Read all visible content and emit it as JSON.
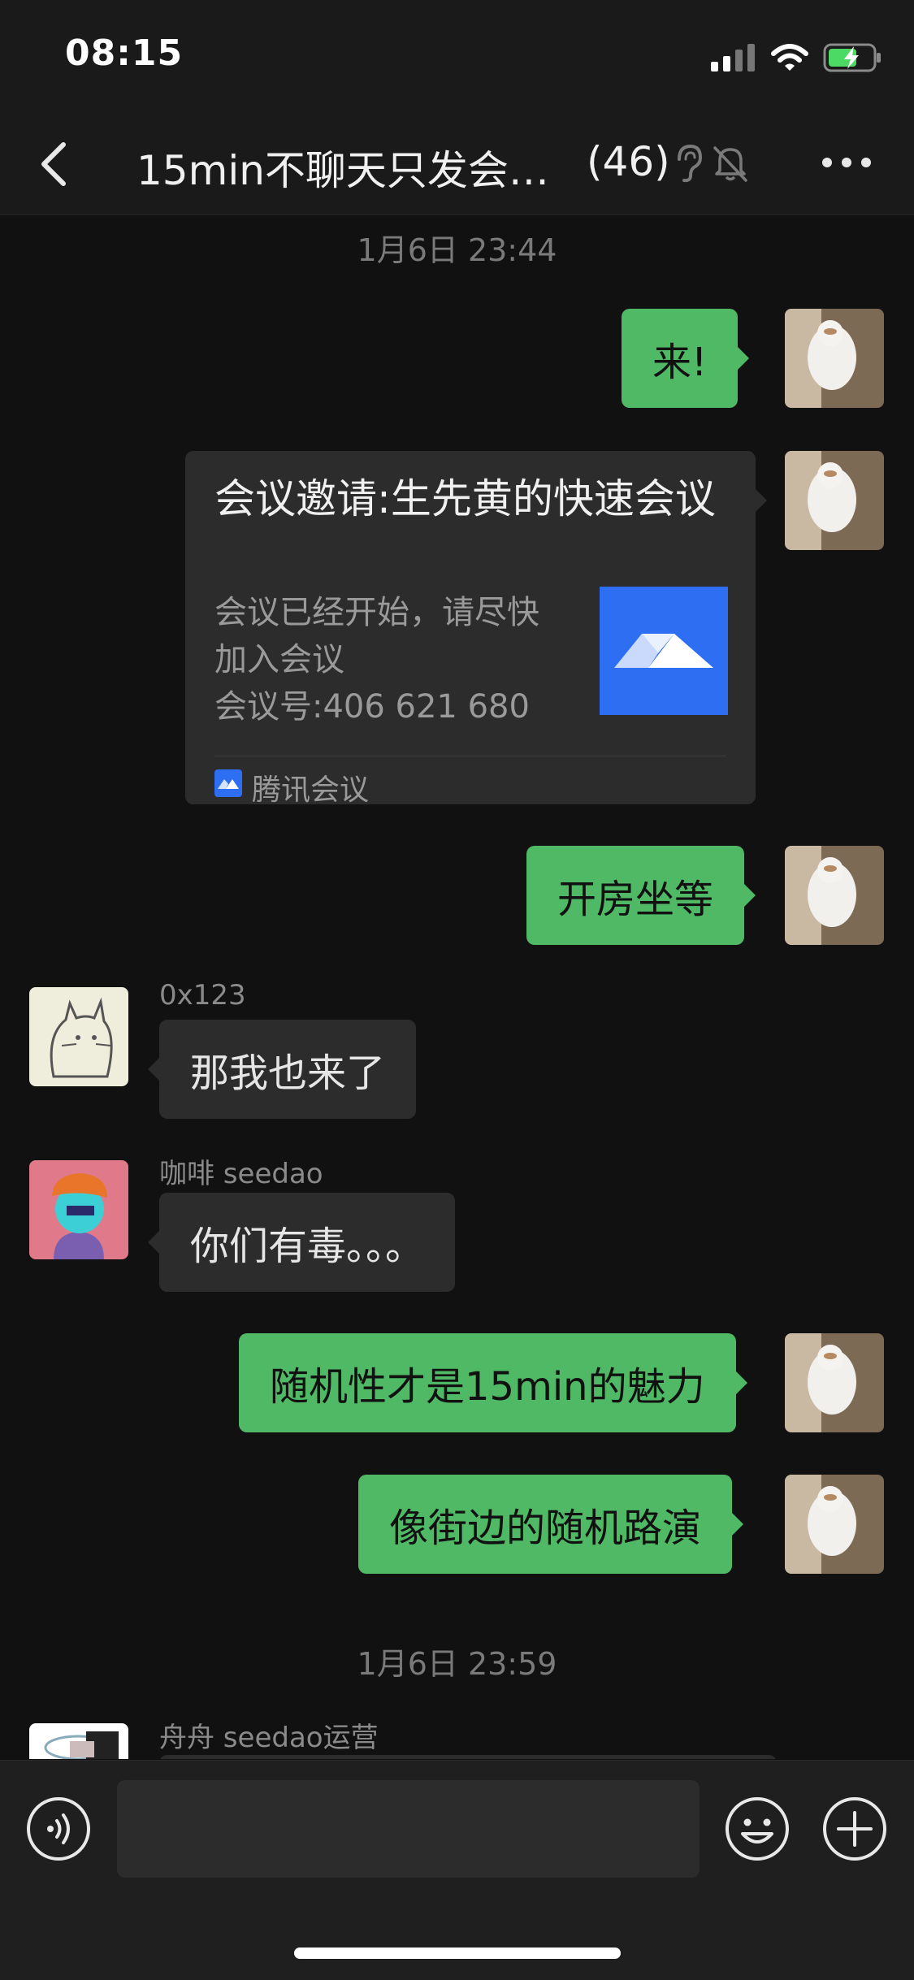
{
  "status_bar": {
    "time": "08:15",
    "icons": [
      "signal-icon",
      "wifi-icon",
      "battery-charging-icon"
    ]
  },
  "header": {
    "title": "15min不聊天只发会…",
    "member_count": "(46)",
    "icons": [
      "back-icon",
      "ear-icon",
      "mute-bell-icon",
      "more-icon"
    ]
  },
  "chat": {
    "timestamp_1": "1月6日 23:44",
    "messages": [
      {
        "from": "me",
        "text": "来!"
      },
      {
        "from": "me",
        "type": "card",
        "title": "会议邀请:生先黄的快速会议",
        "desc_line1": "会议已经开始，请尽快",
        "desc_line2": "加入会议",
        "desc_line3": "会议号:406 621 680",
        "source": "腾讯会议"
      },
      {
        "from": "me",
        "text": "开房坐等"
      },
      {
        "from": "other",
        "sender": "0x123",
        "text": "那我也来了"
      },
      {
        "from": "other",
        "sender": "咖啡 seedao",
        "text": "你们有毒。。。"
      },
      {
        "from": "me",
        "text": "随机性才是15min的魅力"
      },
      {
        "from": "me",
        "text": "像街边的随机路演"
      },
      {
        "from": "other",
        "sender": "舟舟 seedao运营"
      }
    ],
    "timestamp_2": "1月6日 23:59"
  },
  "input_bar": {
    "placeholder": "",
    "icons": [
      "voice-icon",
      "emoji-icon",
      "plus-icon"
    ]
  },
  "colors": {
    "background": "#111111",
    "bubble_mine": "#4fb966",
    "bubble_other": "#2c2c2c",
    "accent_blue": "#2e6ef2"
  }
}
